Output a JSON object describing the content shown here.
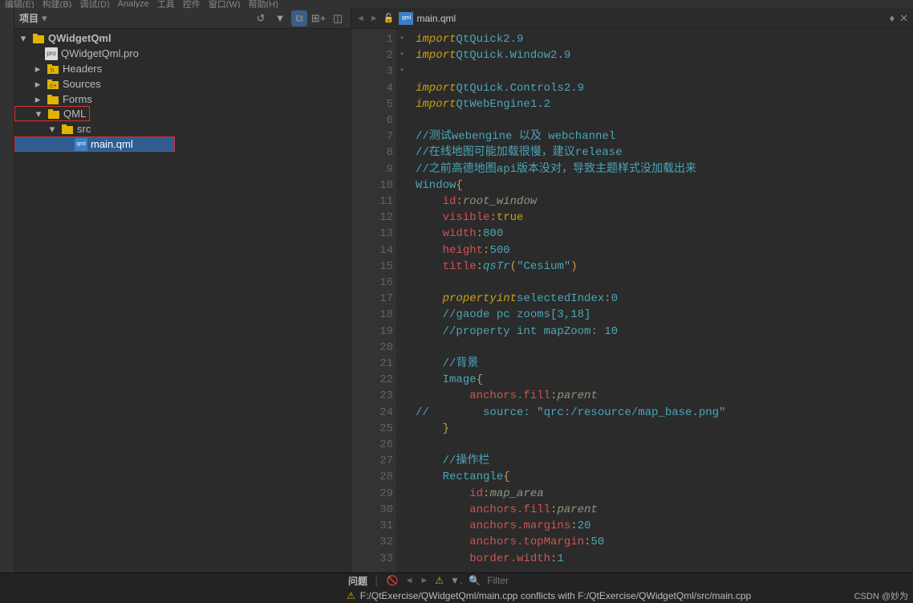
{
  "menubar": [
    "编辑(E)",
    "构建(B)",
    "调试(D)",
    "Analyze",
    "工具",
    "控件",
    "窗口(W)",
    "帮助(H)"
  ],
  "project_panel": {
    "title": "项目",
    "tree": {
      "root": "QWidgetQml",
      "items": [
        {
          "icon": "pro",
          "label": "QWidgetQml.pro"
        },
        {
          "icon": "folder-h",
          "label": "Headers"
        },
        {
          "icon": "folder",
          "label": "Sources"
        },
        {
          "icon": "folder",
          "label": "Forms"
        },
        {
          "icon": "folder",
          "label": "QML",
          "highlight": true
        },
        {
          "icon": "folder",
          "label": "src",
          "indent": 1
        },
        {
          "icon": "qml",
          "label": "main.qml",
          "indent": 2,
          "selected": true,
          "highlight": true
        }
      ]
    }
  },
  "editor": {
    "file_icon": "qml",
    "filename": "main.qml",
    "lines": [
      {
        "n": 1,
        "t": [
          [
            "kw",
            "import"
          ],
          [
            " "
          ],
          [
            "mod",
            "QtQuick"
          ],
          [
            " "
          ],
          [
            "mod",
            "2.9"
          ]
        ]
      },
      {
        "n": 2,
        "t": [
          [
            "kw",
            "import"
          ],
          [
            " "
          ],
          [
            "mod",
            "QtQuick.Window"
          ],
          [
            " "
          ],
          [
            "mod",
            "2.9"
          ]
        ]
      },
      {
        "n": 3,
        "t": []
      },
      {
        "n": 4,
        "t": [
          [
            "kw",
            "import"
          ],
          [
            " "
          ],
          [
            "mod",
            "QtQuick.Controls"
          ],
          [
            " "
          ],
          [
            "mod",
            "2.9"
          ]
        ]
      },
      {
        "n": 5,
        "t": [
          [
            "kw",
            "import"
          ],
          [
            " "
          ],
          [
            "mod",
            "QtWebEngine"
          ],
          [
            " "
          ],
          [
            "mod",
            "1.2"
          ]
        ]
      },
      {
        "n": 6,
        "t": []
      },
      {
        "n": 7,
        "t": [
          [
            "cmt",
            "//测试webengine 以及 webchannel"
          ]
        ]
      },
      {
        "n": 8,
        "t": [
          [
            "cmt",
            "//在线地图可能加载很慢，建议release"
          ]
        ]
      },
      {
        "n": 9,
        "t": [
          [
            "cmt",
            "//之前高德地图api版本没对，导致主题样式没加载出来"
          ]
        ]
      },
      {
        "n": 10,
        "fold": "down",
        "t": [
          [
            "ident",
            "Window"
          ],
          [
            " "
          ],
          [
            "punct",
            "{"
          ]
        ]
      },
      {
        "n": 11,
        "t": [
          [
            "",
            "    "
          ],
          [
            "prop",
            "id"
          ],
          [
            "punct",
            ":"
          ],
          [
            " "
          ],
          [
            "it",
            "root_window"
          ]
        ]
      },
      {
        "n": 12,
        "t": [
          [
            "",
            "    "
          ],
          [
            "prop",
            "visible"
          ],
          [
            "punct",
            ":"
          ],
          [
            " "
          ],
          [
            "val",
            "true"
          ]
        ]
      },
      {
        "n": 13,
        "t": [
          [
            "",
            "    "
          ],
          [
            "prop",
            "width"
          ],
          [
            "punct",
            ":"
          ],
          [
            " "
          ],
          [
            "mod",
            "800"
          ]
        ]
      },
      {
        "n": 14,
        "t": [
          [
            "",
            "    "
          ],
          [
            "prop",
            "height"
          ],
          [
            "punct",
            ":"
          ],
          [
            " "
          ],
          [
            "mod",
            "500"
          ]
        ]
      },
      {
        "n": 15,
        "t": [
          [
            "",
            "    "
          ],
          [
            "prop",
            "title"
          ],
          [
            "punct",
            ":"
          ],
          [
            " "
          ],
          [
            "builtin",
            "qsTr"
          ],
          [
            "punct",
            "("
          ],
          [
            "str",
            "\"Cesium\""
          ],
          [
            "punct",
            ")"
          ]
        ]
      },
      {
        "n": 16,
        "t": []
      },
      {
        "n": 17,
        "t": [
          [
            "",
            "    "
          ],
          [
            "kw",
            "property"
          ],
          [
            " "
          ],
          [
            "kw",
            "int"
          ],
          [
            " "
          ],
          [
            "ident",
            "selectedIndex"
          ],
          [
            "punct",
            ":"
          ],
          [
            " "
          ],
          [
            "mod",
            "0"
          ]
        ]
      },
      {
        "n": 18,
        "t": [
          [
            "",
            "    "
          ],
          [
            "cmt",
            "//gaode pc zooms[3,18]"
          ]
        ]
      },
      {
        "n": 19,
        "t": [
          [
            "",
            "    "
          ],
          [
            "cmt",
            "//property int mapZoom: 10"
          ]
        ]
      },
      {
        "n": 20,
        "t": []
      },
      {
        "n": 21,
        "t": [
          [
            "",
            "    "
          ],
          [
            "cmt",
            "//背景"
          ]
        ]
      },
      {
        "n": 22,
        "fold": "down",
        "t": [
          [
            "",
            "    "
          ],
          [
            "ident",
            "Image"
          ],
          [
            "punct",
            "{"
          ]
        ]
      },
      {
        "n": 23,
        "t": [
          [
            "",
            "        "
          ],
          [
            "prop",
            "anchors.fill"
          ],
          [
            "punct",
            ":"
          ],
          [
            "it",
            "parent"
          ]
        ]
      },
      {
        "n": 24,
        "t": [
          [
            "cmt",
            "//        source: \"qrc:/resource/map_base.png\""
          ]
        ]
      },
      {
        "n": 25,
        "t": [
          [
            "",
            "    "
          ],
          [
            "punct",
            "}"
          ]
        ]
      },
      {
        "n": 26,
        "t": []
      },
      {
        "n": 27,
        "t": [
          [
            "",
            "    "
          ],
          [
            "cmt",
            "//操作栏"
          ]
        ]
      },
      {
        "n": 28,
        "fold": "down",
        "t": [
          [
            "",
            "    "
          ],
          [
            "ident",
            "Rectangle"
          ],
          [
            "punct",
            "{"
          ]
        ]
      },
      {
        "n": 29,
        "t": [
          [
            "",
            "        "
          ],
          [
            "prop",
            "id"
          ],
          [
            "punct",
            ":"
          ],
          [
            " "
          ],
          [
            "it",
            "map_area"
          ]
        ]
      },
      {
        "n": 30,
        "t": [
          [
            "",
            "        "
          ],
          [
            "prop",
            "anchors.fill"
          ],
          [
            "punct",
            ":"
          ],
          [
            " "
          ],
          [
            "it",
            "parent"
          ]
        ]
      },
      {
        "n": 31,
        "t": [
          [
            "",
            "        "
          ],
          [
            "prop",
            "anchors.margins"
          ],
          [
            "punct",
            ":"
          ],
          [
            " "
          ],
          [
            "mod",
            "20"
          ]
        ]
      },
      {
        "n": 32,
        "t": [
          [
            "",
            "        "
          ],
          [
            "prop",
            "anchors.topMargin"
          ],
          [
            "punct",
            ":"
          ],
          [
            " "
          ],
          [
            "mod",
            "50"
          ]
        ]
      },
      {
        "n": 33,
        "t": [
          [
            "",
            "        "
          ],
          [
            "prop",
            "border.width"
          ],
          [
            "punct",
            ":"
          ],
          [
            " "
          ],
          [
            "mod",
            "1"
          ]
        ]
      }
    ]
  },
  "status": {
    "issues_label": "问题",
    "filter_placeholder": "Filter",
    "warning_text": "F:/QtExercise/QWidgetQml/main.cpp conflicts with F:/QtExercise/QWidgetQml/src/main.cpp",
    "watermark": "CSDN @妙为"
  }
}
